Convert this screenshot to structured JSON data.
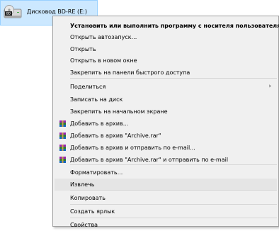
{
  "drive": {
    "label": "Дисковод BD-RE (E:)",
    "icon": "bd-drive-icon"
  },
  "menu": {
    "items": [
      {
        "label": "Установить или выполнить программу с носителя пользователя",
        "bold": true
      },
      {
        "label": "Открыть автозапуск..."
      },
      {
        "label": "Открыть"
      },
      {
        "label": "Открыть в новом окне"
      },
      {
        "label": "Закрепить на панели быстрого доступа"
      },
      {
        "label": "Поделиться",
        "submenu": true
      },
      {
        "label": "Записать на диск"
      },
      {
        "label": "Закрепить на начальном экране"
      },
      {
        "label": "Добавить в архив...",
        "icon": "winrar-icon"
      },
      {
        "label": "Добавить в архив \"Archive.rar\"",
        "icon": "winrar-icon"
      },
      {
        "label": "Добавить в архив и отправить по e-mail...",
        "icon": "winrar-icon"
      },
      {
        "label": "Добавить в архив \"Archive.rar\" и отправить по e-mail",
        "icon": "winrar-icon"
      },
      {
        "label": "Форматировать..."
      },
      {
        "label": "Извлечь",
        "highlighted": true
      },
      {
        "label": "Копировать"
      },
      {
        "label": "Создать ярлык"
      },
      {
        "label": "Свойства"
      }
    ],
    "submenu_arrow": "›"
  },
  "colors": {
    "menu_bg": "#f0f0f0",
    "highlight": "#e5e5e5",
    "selection": "#cce8ff"
  }
}
